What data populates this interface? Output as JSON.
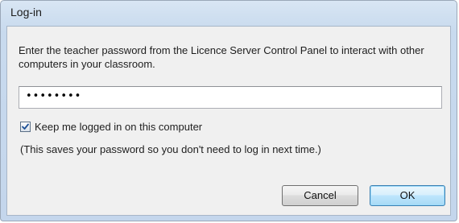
{
  "window": {
    "title": "Log-in"
  },
  "dialog": {
    "message": "Enter the teacher password from the Licence Server Control Panel to interact with other computers in your classroom.",
    "password_value": "••••••••",
    "keep_logged_in_label": "Keep me logged in on this computer",
    "keep_logged_in_checked": true,
    "hint": "(This saves your password so you don't need to log in next time.)"
  },
  "buttons": {
    "cancel_label": "Cancel",
    "ok_label": "OK"
  },
  "colors": {
    "titlebar": "#cfdff0",
    "client": "#f0f0f0",
    "ok_border": "#3c7fb1"
  }
}
